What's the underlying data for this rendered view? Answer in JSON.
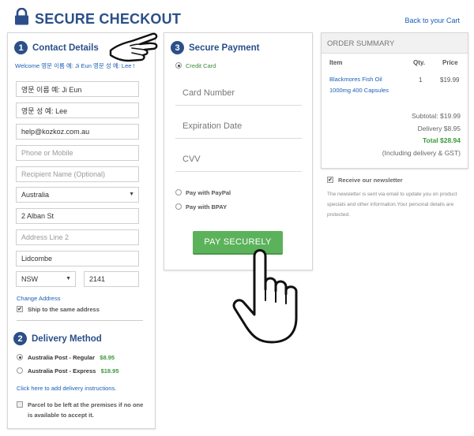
{
  "header": {
    "title": "SECURE CHECKOUT",
    "back_link": "Back to your Cart"
  },
  "contact": {
    "step": "1",
    "title": "Contact Details",
    "welcome": "Welcome 영문 이름 예: Ji Eun 영문 성 예: Lee !",
    "fields": {
      "first_name": "영문 이름 예: Ji Eun",
      "last_name": "영문 성 예: Lee",
      "email": "help@kozkoz.com.au",
      "phone_placeholder": "Phone or Mobile",
      "recipient_placeholder": "Recipient Name (Optional)",
      "country": "Australia",
      "address1": "2 Alban St",
      "address2_placeholder": "Address Line 2",
      "suburb": "Lidcombe",
      "state": "NSW",
      "postcode": "2141"
    },
    "change_address": "Change Address",
    "ship_same": "Ship to the same address"
  },
  "delivery": {
    "step": "2",
    "title": "Delivery Method",
    "options": [
      {
        "label": "Australia Post - Regular",
        "price": "$8.95",
        "selected": true
      },
      {
        "label": "Australia Post - Express",
        "price": "$18.95",
        "selected": false
      }
    ],
    "instructions_link": "Click here to add delivery instructions.",
    "parcel_label": "Parcel to be left at the premises if no one is available to accept it."
  },
  "payment": {
    "step": "3",
    "title": "Secure Payment",
    "credit_card": "Credit Card",
    "card_number_placeholder": "Card Number",
    "expiration_placeholder": "Expiration Date",
    "cvv_placeholder": "CVV",
    "paypal": "Pay with PayPal",
    "bpay": "Pay with BPAY",
    "pay_button": "PAY SECURELY"
  },
  "summary": {
    "title": "ORDER SUMMARY",
    "col_item": "Item",
    "col_qty": "Qty.",
    "col_price": "Price",
    "item_name_1": "Blackmores Fish Oil",
    "item_name_2": "1000mg 400 Capsules",
    "item_qty": "1",
    "item_price": "$19.99",
    "subtotal": "Subtotal: $19.99",
    "delivery": "Delivery $8.95",
    "total": "Total $28.94",
    "including": "(Including delivery & GST)"
  },
  "newsletter": {
    "label": "Receive our newsletter",
    "note": "The newsletter is sent via email to update you on product specials and other information.Your personal details are protected."
  },
  "colors": {
    "brand_blue": "#2b4f8a",
    "link_blue": "#1a5fb4",
    "button_green": "#5bb25b",
    "total_green": "#3a9a3a"
  }
}
